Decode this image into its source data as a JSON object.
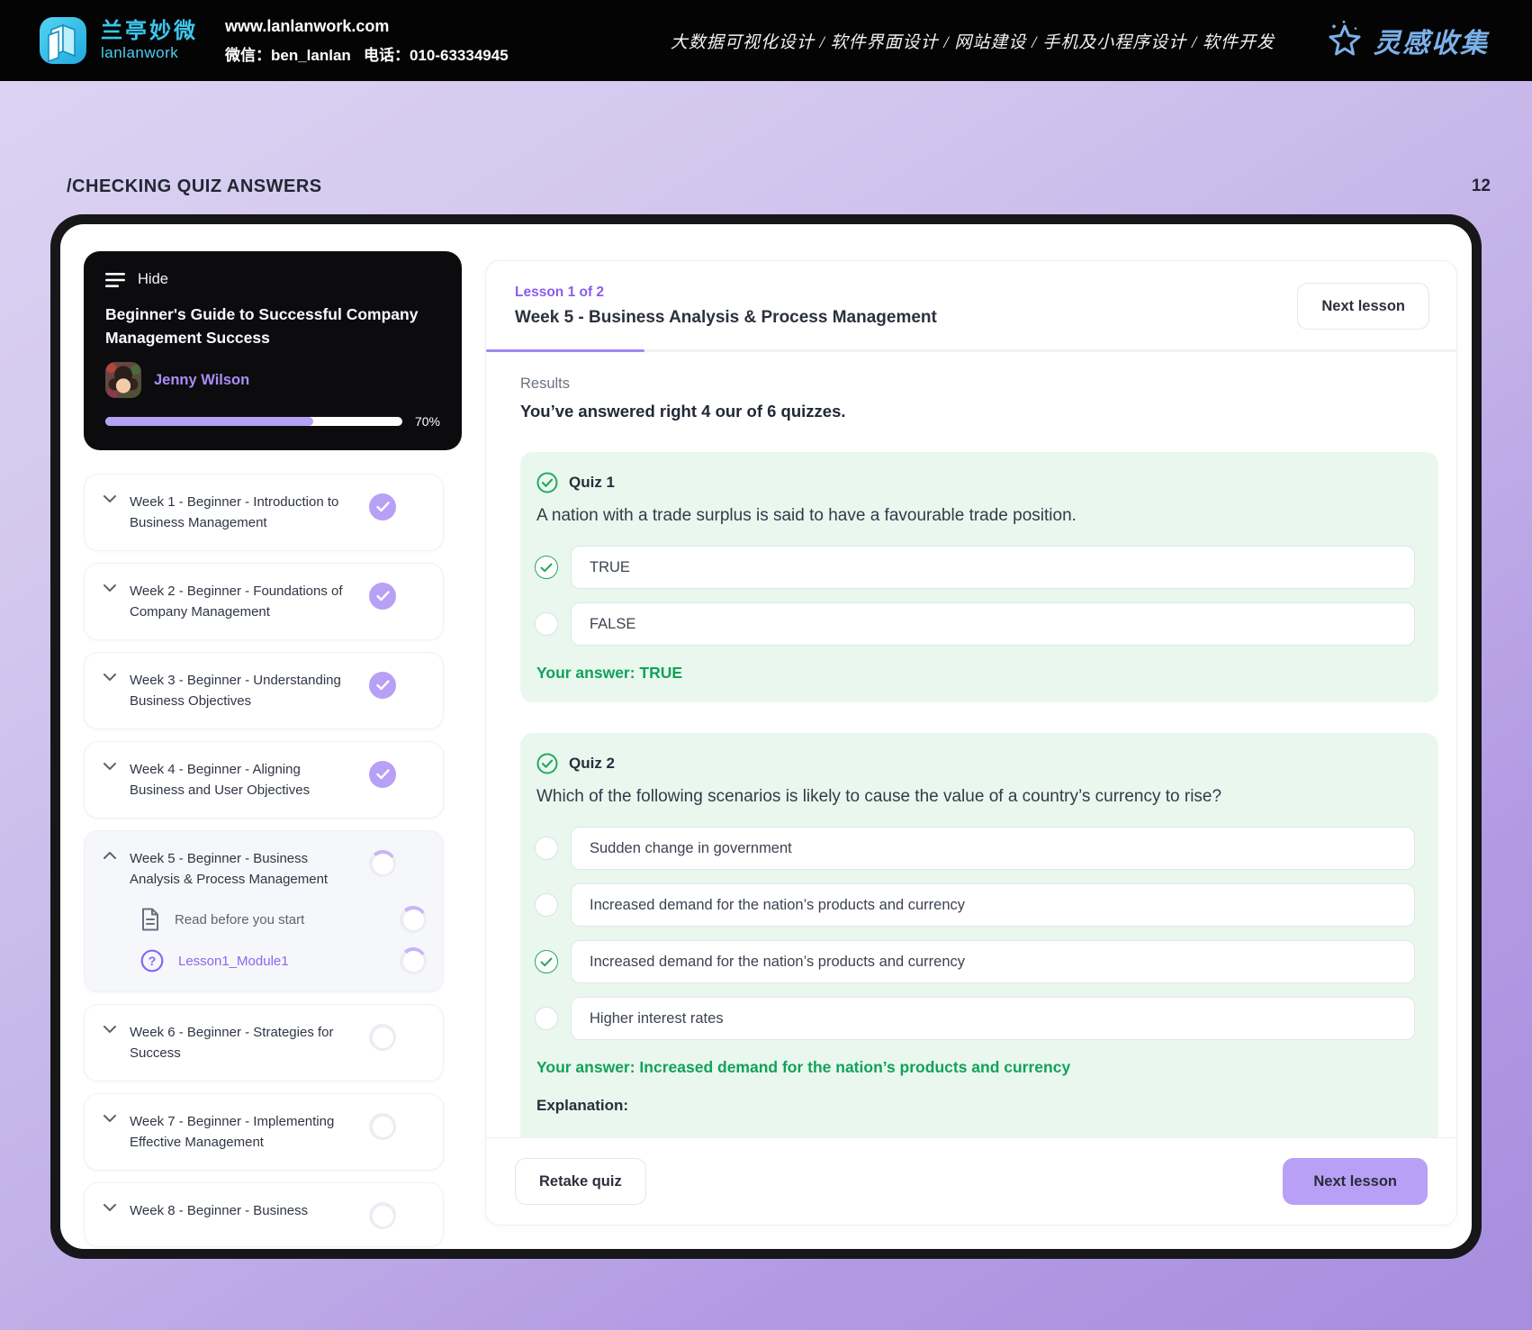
{
  "page": {
    "breadcrumb": "/CHECKING QUIZ ANSWERS",
    "page_number": "12"
  },
  "brand_bar": {
    "logo_title": "兰亭妙微",
    "logo_subtitle": "lanlanwork",
    "website": "www.lanlanwork.com",
    "wechat": "微信：ben_lanlan",
    "phone": "电话：010-63334945",
    "services": "大数据可视化设计 / 软件界面设计 / 网站建设 / 手机及小程序设计 / 软件开发",
    "collect_label": "灵感收集"
  },
  "sidebar": {
    "hide_label": "Hide",
    "course_title": "Beginner's Guide to Successful Company Management Success",
    "instructor": "Jenny Wilson",
    "progress_percent": "70%",
    "progress_value": 70,
    "weeks": [
      {
        "label": "Week 1 - Beginner - Introduction to Business Management",
        "status": "complete"
      },
      {
        "label": "Week 2 - Beginner - Foundations of Company Management",
        "status": "complete"
      },
      {
        "label": "Week 3 - Beginner - Understanding Business Objectives",
        "status": "complete"
      },
      {
        "label": "Week 4 - Beginner - Aligning Business and User Objectives",
        "status": "complete"
      },
      {
        "label": "Week 5 - Beginner - Business Analysis & Process Management",
        "status": "current",
        "expanded": true,
        "items": [
          {
            "label": "Read before you start",
            "icon": "document-icon",
            "ring": "arc"
          },
          {
            "label": "Lesson1_Module1",
            "icon": "question-icon",
            "accent": true,
            "ring": "plain"
          }
        ]
      },
      {
        "label": "Week 6 - Beginner - Strategies for Success",
        "status": "incomplete"
      },
      {
        "label": "Week 7 - Beginner - Implementing Effective Management",
        "status": "incomplete"
      },
      {
        "label": "Week 8 - Beginner - Business",
        "status": "incomplete"
      }
    ]
  },
  "lesson": {
    "counter": "Lesson 1 of 2",
    "title": "Week 5 - Business Analysis & Process Management",
    "next_lesson_label": "Next lesson"
  },
  "results": {
    "heading": "Results",
    "summary": "You’ve answered right 4 our of 6 quizzes."
  },
  "quizzes": [
    {
      "name": "Quiz 1",
      "question": "A nation with a trade surplus is said to have a favourable trade position.",
      "options": [
        {
          "label": "TRUE",
          "checked": true
        },
        {
          "label": "FALSE",
          "checked": false
        }
      ],
      "your_answer": "Your answer: TRUE"
    },
    {
      "name": "Quiz 2",
      "question": "Which of the following scenarios is likely to cause the value of a country’s currency to rise?",
      "options": [
        {
          "label": "Sudden change in government",
          "checked": false
        },
        {
          "label": "Increased demand for the nation’s products and currency",
          "checked": false
        },
        {
          "label": "Increased demand for the nation’s products and currency",
          "checked": true
        },
        {
          "label": "Higher interest rates",
          "checked": false
        }
      ],
      "your_answer": "Your answer: Increased demand for the nation’s products and currency",
      "explanation_label": "Explanation:",
      "runoff": true
    }
  ],
  "footer": {
    "retake_label": "Retake quiz",
    "next_label": "Next lesson"
  },
  "colors": {
    "accent-purple": "#8a5cf0",
    "purple-light": "#b7a0f5",
    "progress-fill": "#b5a1f1",
    "success-green": "#1ca65c",
    "quiz-bg": "#e9f7ef",
    "brand-cyan": "#3cc7ec",
    "collect-blue": "#7cb1e9"
  }
}
